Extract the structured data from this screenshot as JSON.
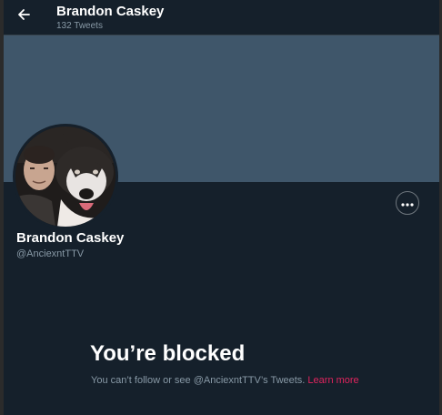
{
  "header": {
    "back_icon": "arrow-left-icon",
    "name": "Brandon Caskey",
    "tweet_count": "132 Tweets"
  },
  "profile": {
    "display_name": "Brandon Caskey",
    "handle": "@AnciexntTTV",
    "more_icon": "more-horizontal-icon"
  },
  "blocked": {
    "title": "You’re blocked",
    "message": "You can’t follow or see @AnciexntTTV’s Tweets. ",
    "link_label": "Learn more"
  },
  "colors": {
    "background": "#15202b",
    "banner": "#3f566a",
    "border": "#38444d",
    "secondary_text": "#8899a6",
    "link": "#e0245e"
  }
}
